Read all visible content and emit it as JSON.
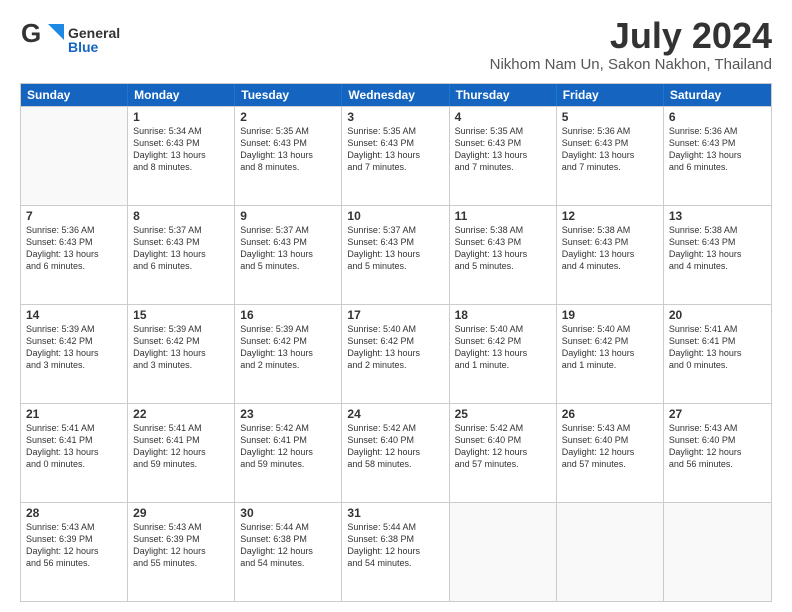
{
  "logo": {
    "general": "General",
    "blue": "Blue"
  },
  "header": {
    "month": "July 2024",
    "location": "Nikhom Nam Un, Sakon Nakhon, Thailand"
  },
  "days": [
    "Sunday",
    "Monday",
    "Tuesday",
    "Wednesday",
    "Thursday",
    "Friday",
    "Saturday"
  ],
  "weeks": [
    [
      {
        "day": "",
        "content": ""
      },
      {
        "day": "1",
        "content": "Sunrise: 5:34 AM\nSunset: 6:43 PM\nDaylight: 13 hours\nand 8 minutes."
      },
      {
        "day": "2",
        "content": "Sunrise: 5:35 AM\nSunset: 6:43 PM\nDaylight: 13 hours\nand 8 minutes."
      },
      {
        "day": "3",
        "content": "Sunrise: 5:35 AM\nSunset: 6:43 PM\nDaylight: 13 hours\nand 7 minutes."
      },
      {
        "day": "4",
        "content": "Sunrise: 5:35 AM\nSunset: 6:43 PM\nDaylight: 13 hours\nand 7 minutes."
      },
      {
        "day": "5",
        "content": "Sunrise: 5:36 AM\nSunset: 6:43 PM\nDaylight: 13 hours\nand 7 minutes."
      },
      {
        "day": "6",
        "content": "Sunrise: 5:36 AM\nSunset: 6:43 PM\nDaylight: 13 hours\nand 6 minutes."
      }
    ],
    [
      {
        "day": "7",
        "content": "Sunrise: 5:36 AM\nSunset: 6:43 PM\nDaylight: 13 hours\nand 6 minutes."
      },
      {
        "day": "8",
        "content": "Sunrise: 5:37 AM\nSunset: 6:43 PM\nDaylight: 13 hours\nand 6 minutes."
      },
      {
        "day": "9",
        "content": "Sunrise: 5:37 AM\nSunset: 6:43 PM\nDaylight: 13 hours\nand 5 minutes."
      },
      {
        "day": "10",
        "content": "Sunrise: 5:37 AM\nSunset: 6:43 PM\nDaylight: 13 hours\nand 5 minutes."
      },
      {
        "day": "11",
        "content": "Sunrise: 5:38 AM\nSunset: 6:43 PM\nDaylight: 13 hours\nand 5 minutes."
      },
      {
        "day": "12",
        "content": "Sunrise: 5:38 AM\nSunset: 6:43 PM\nDaylight: 13 hours\nand 4 minutes."
      },
      {
        "day": "13",
        "content": "Sunrise: 5:38 AM\nSunset: 6:43 PM\nDaylight: 13 hours\nand 4 minutes."
      }
    ],
    [
      {
        "day": "14",
        "content": "Sunrise: 5:39 AM\nSunset: 6:42 PM\nDaylight: 13 hours\nand 3 minutes."
      },
      {
        "day": "15",
        "content": "Sunrise: 5:39 AM\nSunset: 6:42 PM\nDaylight: 13 hours\nand 3 minutes."
      },
      {
        "day": "16",
        "content": "Sunrise: 5:39 AM\nSunset: 6:42 PM\nDaylight: 13 hours\nand 2 minutes."
      },
      {
        "day": "17",
        "content": "Sunrise: 5:40 AM\nSunset: 6:42 PM\nDaylight: 13 hours\nand 2 minutes."
      },
      {
        "day": "18",
        "content": "Sunrise: 5:40 AM\nSunset: 6:42 PM\nDaylight: 13 hours\nand 1 minute."
      },
      {
        "day": "19",
        "content": "Sunrise: 5:40 AM\nSunset: 6:42 PM\nDaylight: 13 hours\nand 1 minute."
      },
      {
        "day": "20",
        "content": "Sunrise: 5:41 AM\nSunset: 6:41 PM\nDaylight: 13 hours\nand 0 minutes."
      }
    ],
    [
      {
        "day": "21",
        "content": "Sunrise: 5:41 AM\nSunset: 6:41 PM\nDaylight: 13 hours\nand 0 minutes."
      },
      {
        "day": "22",
        "content": "Sunrise: 5:41 AM\nSunset: 6:41 PM\nDaylight: 12 hours\nand 59 minutes."
      },
      {
        "day": "23",
        "content": "Sunrise: 5:42 AM\nSunset: 6:41 PM\nDaylight: 12 hours\nand 59 minutes."
      },
      {
        "day": "24",
        "content": "Sunrise: 5:42 AM\nSunset: 6:40 PM\nDaylight: 12 hours\nand 58 minutes."
      },
      {
        "day": "25",
        "content": "Sunrise: 5:42 AM\nSunset: 6:40 PM\nDaylight: 12 hours\nand 57 minutes."
      },
      {
        "day": "26",
        "content": "Sunrise: 5:43 AM\nSunset: 6:40 PM\nDaylight: 12 hours\nand 57 minutes."
      },
      {
        "day": "27",
        "content": "Sunrise: 5:43 AM\nSunset: 6:40 PM\nDaylight: 12 hours\nand 56 minutes."
      }
    ],
    [
      {
        "day": "28",
        "content": "Sunrise: 5:43 AM\nSunset: 6:39 PM\nDaylight: 12 hours\nand 56 minutes."
      },
      {
        "day": "29",
        "content": "Sunrise: 5:43 AM\nSunset: 6:39 PM\nDaylight: 12 hours\nand 55 minutes."
      },
      {
        "day": "30",
        "content": "Sunrise: 5:44 AM\nSunset: 6:38 PM\nDaylight: 12 hours\nand 54 minutes."
      },
      {
        "day": "31",
        "content": "Sunrise: 5:44 AM\nSunset: 6:38 PM\nDaylight: 12 hours\nand 54 minutes."
      },
      {
        "day": "",
        "content": ""
      },
      {
        "day": "",
        "content": ""
      },
      {
        "day": "",
        "content": ""
      }
    ]
  ]
}
